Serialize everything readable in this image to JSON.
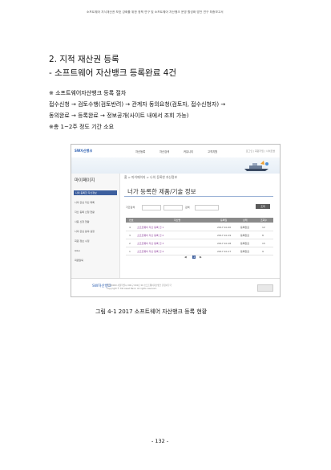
{
  "header": {
    "running_title": "소프트웨어 지식재산권 보호 강화를 위한 정책 연구 및 소프트웨어 자산뱅크 운영 활성화 방안 연구 최종보고서"
  },
  "section": {
    "title": "2. 지적 재산권 등록",
    "subtitle": "- 소프트웨어 자산뱅크 등록완료 4건"
  },
  "body": {
    "line1": "※ 소프트웨어자산뱅크 등록 절차",
    "line2": "접수신청 → 검토수행(검토반려) → 관계자 동의요청(검토자, 접수신청자) →",
    "line3": "동의완료 → 등록완료 → 정보공개(사이트 내에서 조회 가능)",
    "line4": "※총 1~2주 정도 기간 소요"
  },
  "figure": {
    "logo": "SW자산뱅크",
    "nav": [
      "자산등록",
      "자산검색",
      "커뮤니티",
      "고객지원"
    ],
    "top_right": "로그인 | 회원가입 | 사이트맵",
    "sidebar": {
      "title": "마이페이지",
      "items": [
        "나의 등록한 자산정보",
        "나의 관심 자산 목록",
        "자산 등록 신청 현황",
        "사용 신청 현황",
        "나의 관심 분야 설정",
        "회원 정보 수정",
        "Q&A",
        "회원탈퇴"
      ]
    },
    "breadcrumb": "홈 > 마이페이지 > 나의 등록한 자산정보",
    "page_title": "너가 등록한 제품/기술 정보",
    "filters": {
      "label": "기간검색",
      "search_label": "검색",
      "button": "조회"
    },
    "table": {
      "columns": [
        "번호",
        "자산명",
        "등록일",
        "상태",
        "조회수"
      ],
      "rows": [
        [
          "4",
          "소프트웨어 자산 등록 건 1",
          "2017.10.20",
          "등록완료",
          "12"
        ],
        [
          "3",
          "소프트웨어 자산 등록 건 2",
          "2017.10.19",
          "등록완료",
          "8"
        ],
        [
          "2",
          "소프트웨어 자산 등록 건 3",
          "2017.10.18",
          "등록완료",
          "15"
        ],
        [
          "1",
          "소프트웨어 자산 등록 건 4",
          "2017.10.17",
          "등록완료",
          "9"
        ]
      ]
    },
    "pager": [
      "◀",
      "1",
      "▶"
    ],
    "footer": {
      "logo": "SW자산뱅크",
      "line1": "(우)00000 서울특별시 000구 000로 00 소프트웨어자산뱅크 운영사무국",
      "line2": "Copyright © SW Asset Bank. All rights reserved."
    }
  },
  "caption": "그림 4-1 2017 소프트웨어 자산뱅크 등록 현황",
  "page_number": "- 132 -"
}
